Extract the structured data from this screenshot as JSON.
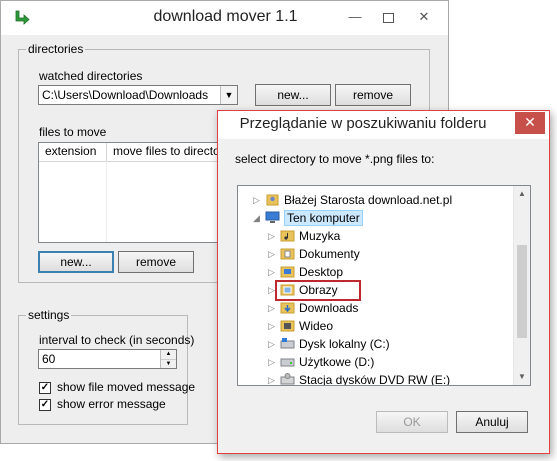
{
  "main_window": {
    "title": "download mover 1.1",
    "directories": {
      "legend": "directories",
      "watched_label": "watched directories",
      "watched_value": "C:\\Users\\Download\\Downloads",
      "new_button": "new...",
      "remove_button": "remove",
      "files_label": "files to move",
      "columns": [
        "extension",
        "move files to directory"
      ],
      "new_button2": "new...",
      "remove_button2": "remove"
    },
    "settings": {
      "legend": "settings",
      "interval_label": "interval to check (in seconds)",
      "interval_value": "60",
      "show_moved_label": "show file moved message",
      "show_moved_checked": true,
      "show_error_label": "show error message",
      "show_error_checked": true
    }
  },
  "dialog": {
    "title": "Przeglądanie w poszukiwaniu folderu",
    "description": "select directory to move *.png files to:",
    "tree": [
      {
        "label": "Błażej Starosta download.net.pl",
        "level": 1,
        "expander": "collapsed",
        "icon": "user-folder-icon",
        "selected": false
      },
      {
        "label": "Ten komputer",
        "level": 1,
        "expander": "expanded",
        "icon": "computer-icon",
        "selected": true
      },
      {
        "label": "Muzyka",
        "level": 2,
        "expander": "collapsed",
        "icon": "music-folder-icon",
        "selected": false
      },
      {
        "label": "Dokumenty",
        "level": 2,
        "expander": "collapsed",
        "icon": "documents-folder-icon",
        "selected": false
      },
      {
        "label": "Desktop",
        "level": 2,
        "expander": "collapsed",
        "icon": "desktop-folder-icon",
        "selected": false
      },
      {
        "label": "Obrazy",
        "level": 2,
        "expander": "collapsed",
        "icon": "pictures-folder-icon",
        "selected": false,
        "highlighted": true
      },
      {
        "label": "Downloads",
        "level": 2,
        "expander": "collapsed",
        "icon": "downloads-folder-icon",
        "selected": false
      },
      {
        "label": "Wideo",
        "level": 2,
        "expander": "collapsed",
        "icon": "video-folder-icon",
        "selected": false
      },
      {
        "label": "Dysk lokalny (C:)",
        "level": 2,
        "expander": "collapsed",
        "icon": "local-disk-icon",
        "selected": false
      },
      {
        "label": "Użytkowe (D:)",
        "level": 2,
        "expander": "collapsed",
        "icon": "drive-icon",
        "selected": false
      },
      {
        "label": "Stacja dysków DVD RW (E:)",
        "level": 2,
        "expander": "collapsed",
        "icon": "dvd-drive-icon",
        "selected": false
      }
    ],
    "ok_button": "OK",
    "cancel_button": "Anuluj"
  },
  "colors": {
    "dialog_border": "#e04040",
    "close_button": "#c7504a",
    "selection": "#cce8ff",
    "highlight_box": "#c0282f"
  }
}
